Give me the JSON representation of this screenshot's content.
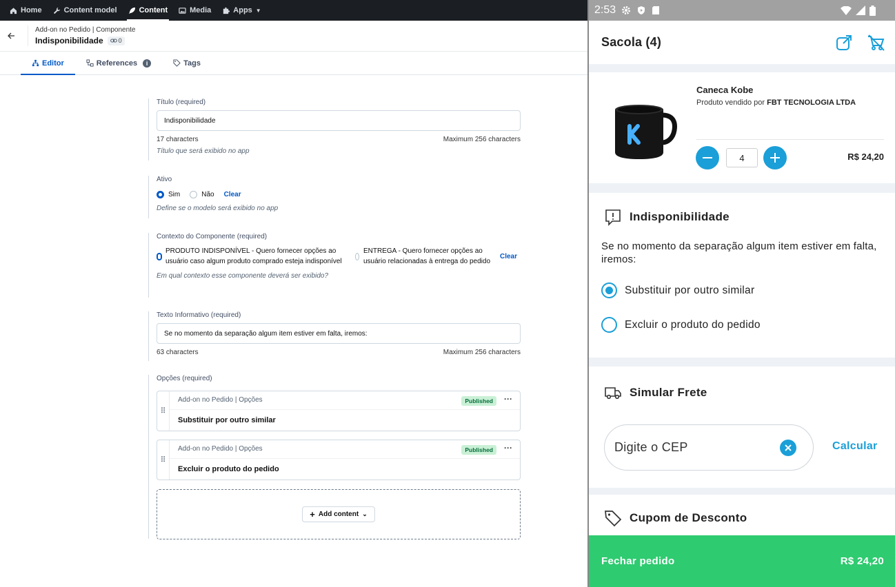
{
  "cms": {
    "nav": [
      {
        "label": "Home",
        "icon": "home-icon"
      },
      {
        "label": "Content model",
        "icon": "wrench-icon"
      },
      {
        "label": "Content",
        "icon": "feather-icon"
      },
      {
        "label": "Media",
        "icon": "image-icon"
      },
      {
        "label": "Apps",
        "icon": "puzzle-icon"
      }
    ],
    "entry": {
      "breadcrumb": "Add-on no Pedido | Componente",
      "title": "Indisponibilidade",
      "link_count": "0"
    },
    "tabs": [
      {
        "label": "Editor",
        "icon": "sitemap-icon"
      },
      {
        "label": "References",
        "icon": "references-icon",
        "info": "i"
      },
      {
        "label": "Tags",
        "icon": "tag-icon"
      }
    ],
    "titulo": {
      "label": "Título (required)",
      "value": "Indisponibilidade",
      "count": "17 characters",
      "max": "Maximum 256 characters",
      "help": "Título que será exibido no app"
    },
    "ativo": {
      "label": "Ativo",
      "opt_yes": "Sim",
      "opt_no": "Não",
      "clear": "Clear",
      "help": "Define se o modelo será exibido no app"
    },
    "contexto": {
      "label": "Contexto do Componente (required)",
      "opt1": "PRODUTO INDISPONÍVEL - Quero fornecer opções ao usuário caso algum produto comprado esteja indisponível",
      "opt2": "ENTREGA - Quero fornecer opções ao usuário relacionadas à entrega do pedido",
      "clear": "Clear",
      "help": "Em qual contexto esse componente deverá ser exibido?"
    },
    "texto": {
      "label": "Texto Informativo (required)",
      "value": "Se no momento da separação algum item estiver em falta, iremos:",
      "count": "63 characters",
      "max": "Maximum 256 characters"
    },
    "opcoes": {
      "label": "Opções (required)",
      "items": [
        {
          "type": "Add-on no Pedido | Opções",
          "status": "Published",
          "title": "Substituir por outro similar"
        },
        {
          "type": "Add-on no Pedido | Opções",
          "status": "Published",
          "title": "Excluir o produto do pedido"
        }
      ],
      "add_label": "Add content"
    }
  },
  "phone": {
    "status": {
      "time": "2:53"
    },
    "appbar": {
      "title": "Sacola (4)"
    },
    "product": {
      "name": "Caneca Kobe",
      "seller_prefix": "Produto vendido por",
      "seller": "FBT TECNOLOGIA LTDA",
      "qty": "4",
      "price": "R$ 24,20"
    },
    "indisponibilidade": {
      "title": "Indisponibilidade",
      "text": "Se no momento da separação algum item estiver em falta, iremos:",
      "options": [
        "Substituir por outro similar",
        "Excluir o produto do pedido"
      ]
    },
    "frete": {
      "title": "Simular Frete",
      "placeholder": "Digite o CEP",
      "action": "Calcular"
    },
    "cupom": {
      "title": "Cupom de Desconto"
    },
    "checkout": {
      "label": "Fechar pedido",
      "total": "R$ 24,20"
    },
    "colors": {
      "accent": "#1a9fd8",
      "checkout": "#2ecb70"
    }
  }
}
